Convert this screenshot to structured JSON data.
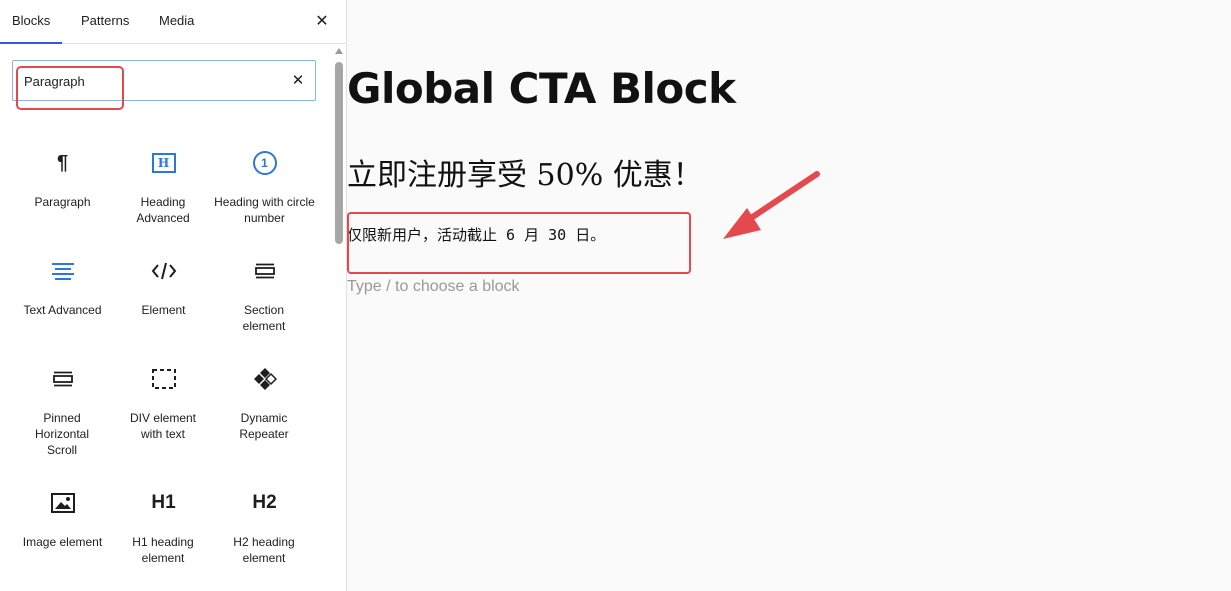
{
  "sidebar": {
    "tabs": [
      {
        "label": "Blocks"
      },
      {
        "label": "Patterns"
      },
      {
        "label": "Media"
      }
    ],
    "close_icon": "close-icon",
    "search": {
      "value": "Paragraph",
      "clear_icon": "close-icon"
    },
    "blocks": [
      {
        "label": "Paragraph",
        "icon": "paragraph-icon"
      },
      {
        "label": "Heading Advanced",
        "icon": "heading-h-box-icon"
      },
      {
        "label": "Heading with circle number",
        "icon": "circle-number-icon"
      },
      {
        "label": "Text Advanced",
        "icon": "text-lines-icon"
      },
      {
        "label": "Element",
        "icon": "code-icon"
      },
      {
        "label": "Section element",
        "icon": "section-icon"
      },
      {
        "label": "Pinned Horizontal Scroll",
        "icon": "pinned-scroll-icon"
      },
      {
        "label": "DIV element with text",
        "icon": "dashed-box-icon"
      },
      {
        "label": "Dynamic Repeater",
        "icon": "repeater-diamond-icon"
      },
      {
        "label": "Image element",
        "icon": "image-icon"
      },
      {
        "label": "H1 heading element",
        "icon": "h1-icon"
      },
      {
        "label": "H2 heading element",
        "icon": "h2-icon"
      }
    ],
    "icon_text": {
      "paragraph": "¶",
      "heading_box": "H",
      "circle_number": "1",
      "h1": "H1",
      "h2": "H2"
    }
  },
  "canvas": {
    "title": "Global CTA Block",
    "subheading": "立即注册享受 50% 优惠！",
    "paragraph": "仅限新用户，活动截止 6 月 30 日。",
    "placeholder": "Type / to choose a block"
  },
  "colors": {
    "accent": "#3858e9",
    "highlight": "#e5484d",
    "icon_blue": "#2b78d8"
  }
}
